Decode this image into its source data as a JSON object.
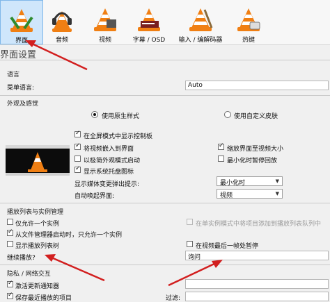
{
  "toolbar": {
    "items": [
      {
        "label": "界面",
        "icon": "interface-cone-icon"
      },
      {
        "label": "音频",
        "icon": "audio-headphones-cone-icon"
      },
      {
        "label": "视频",
        "icon": "video-cone-icon"
      },
      {
        "label": "字幕 / OSD",
        "icon": "subtitles-cone-icon"
      },
      {
        "label": "输入 / 编解码器",
        "icon": "input-codecs-cone-icon"
      },
      {
        "label": "热键",
        "icon": "hotkeys-cone-icon"
      }
    ]
  },
  "page_title": "界面设置",
  "language": {
    "section": "语言",
    "menu_language_label": "菜单语言:",
    "menu_language_value": "Auto"
  },
  "look_feel": {
    "section": "外观及感觉",
    "native_style": "使用原生样式",
    "custom_skin": "使用自定义皮肤",
    "left_options": [
      {
        "label": "在全屏模式中显示控制板",
        "checked": true
      },
      {
        "label": "将视频嵌入到界面",
        "checked": true
      },
      {
        "label": "以极简外观模式启动",
        "checked": false
      },
      {
        "label": "显示系统托盘图标",
        "checked": true
      }
    ],
    "right_options": [
      {
        "label": "缩放界面至视频大小",
        "checked": true
      },
      {
        "label": "最小化时暂停回放",
        "checked": false
      }
    ],
    "media_change_popup_label": "显示媒体变更弹出提示:",
    "media_change_popup_value": "最小化时",
    "auto_raise_label": "自动唤起界面:",
    "auto_raise_value": "视频"
  },
  "playlist": {
    "section": "播放列表与实例管理",
    "single_instance": "仅允许一个实例",
    "single_instance_checked": false,
    "enqueue_single": "在单实例模式中将项目添加到播放列表队列中",
    "file_manager_single": "从文件管理器启动时，只允许一个实例",
    "file_manager_single_checked": true,
    "show_playlist_tree": "显示播放列表树",
    "show_playlist_tree_checked": false,
    "pause_last_frame": "在视频最后一帧处暂停",
    "pause_last_frame_checked": false,
    "resume_label": "继续播放?",
    "resume_value": "询问"
  },
  "privacy": {
    "section": "隐私 / 网络交互",
    "activate_updates": "激活更新通知器",
    "activate_updates_checked": true,
    "save_recent": "保存最近播放的项目",
    "save_recent_checked": true,
    "filter_label": "过滤:"
  }
}
